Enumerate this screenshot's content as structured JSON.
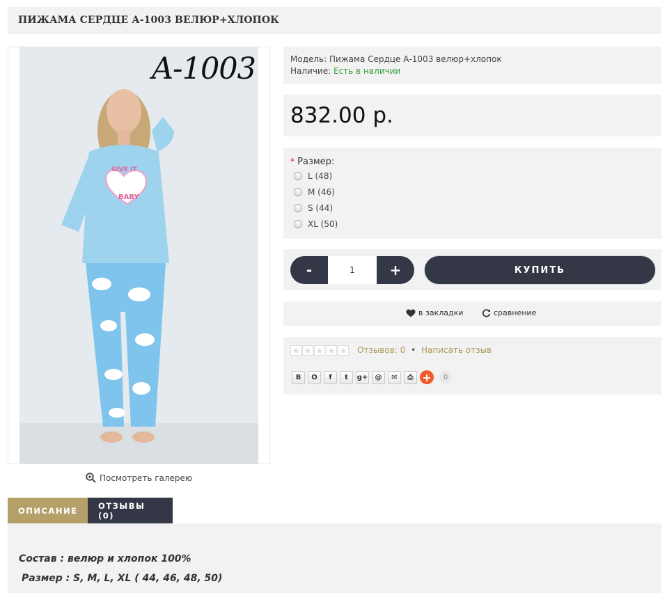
{
  "product": {
    "title": "ПИЖАМА СЕРДЦЕ А-1003 ВЕЛЮР+ХЛОПОК",
    "image_label": "A-1003",
    "gallery_link": "Посмотреть галерею"
  },
  "info": {
    "model_label": "Модель:",
    "model_value": "Пижама Сердце А-1003 велюр+хлопок",
    "availability_label": "Наличие:",
    "availability_value": "Есть в наличии"
  },
  "price": "832.00 р.",
  "size": {
    "required_mark": "*",
    "label": "Размер:",
    "options": [
      "L (48)",
      "M (46)",
      "S (44)",
      "XL (50)"
    ]
  },
  "buy": {
    "minus": "-",
    "quantity": "1",
    "plus": "+",
    "buy_label": "КУПИТЬ"
  },
  "actions": {
    "wishlist": "в закладки",
    "compare": "сравнение"
  },
  "rating": {
    "reviews_count": "Отзывов: 0",
    "separator": "•",
    "write_review": "Написать отзыв"
  },
  "share": {
    "buttons": [
      "В",
      "О",
      "f",
      "t",
      "g+",
      "@",
      "✉",
      "⎙"
    ],
    "count": "0"
  },
  "tabs": {
    "description": "ОПИСАНИЕ",
    "reviews": "ОТЗЫВЫ (0)"
  },
  "description": {
    "line1": "Состав : велюр и хлопок 100%",
    "line2": "Размер : S, M, L, XL ( 44, 46, 48, 50)"
  },
  "colors": {
    "panel_bg": "#f2f2f2",
    "dark_button": "#343846",
    "gold_accent": "#b5a06a",
    "stock_green": "#3a9d3a"
  }
}
